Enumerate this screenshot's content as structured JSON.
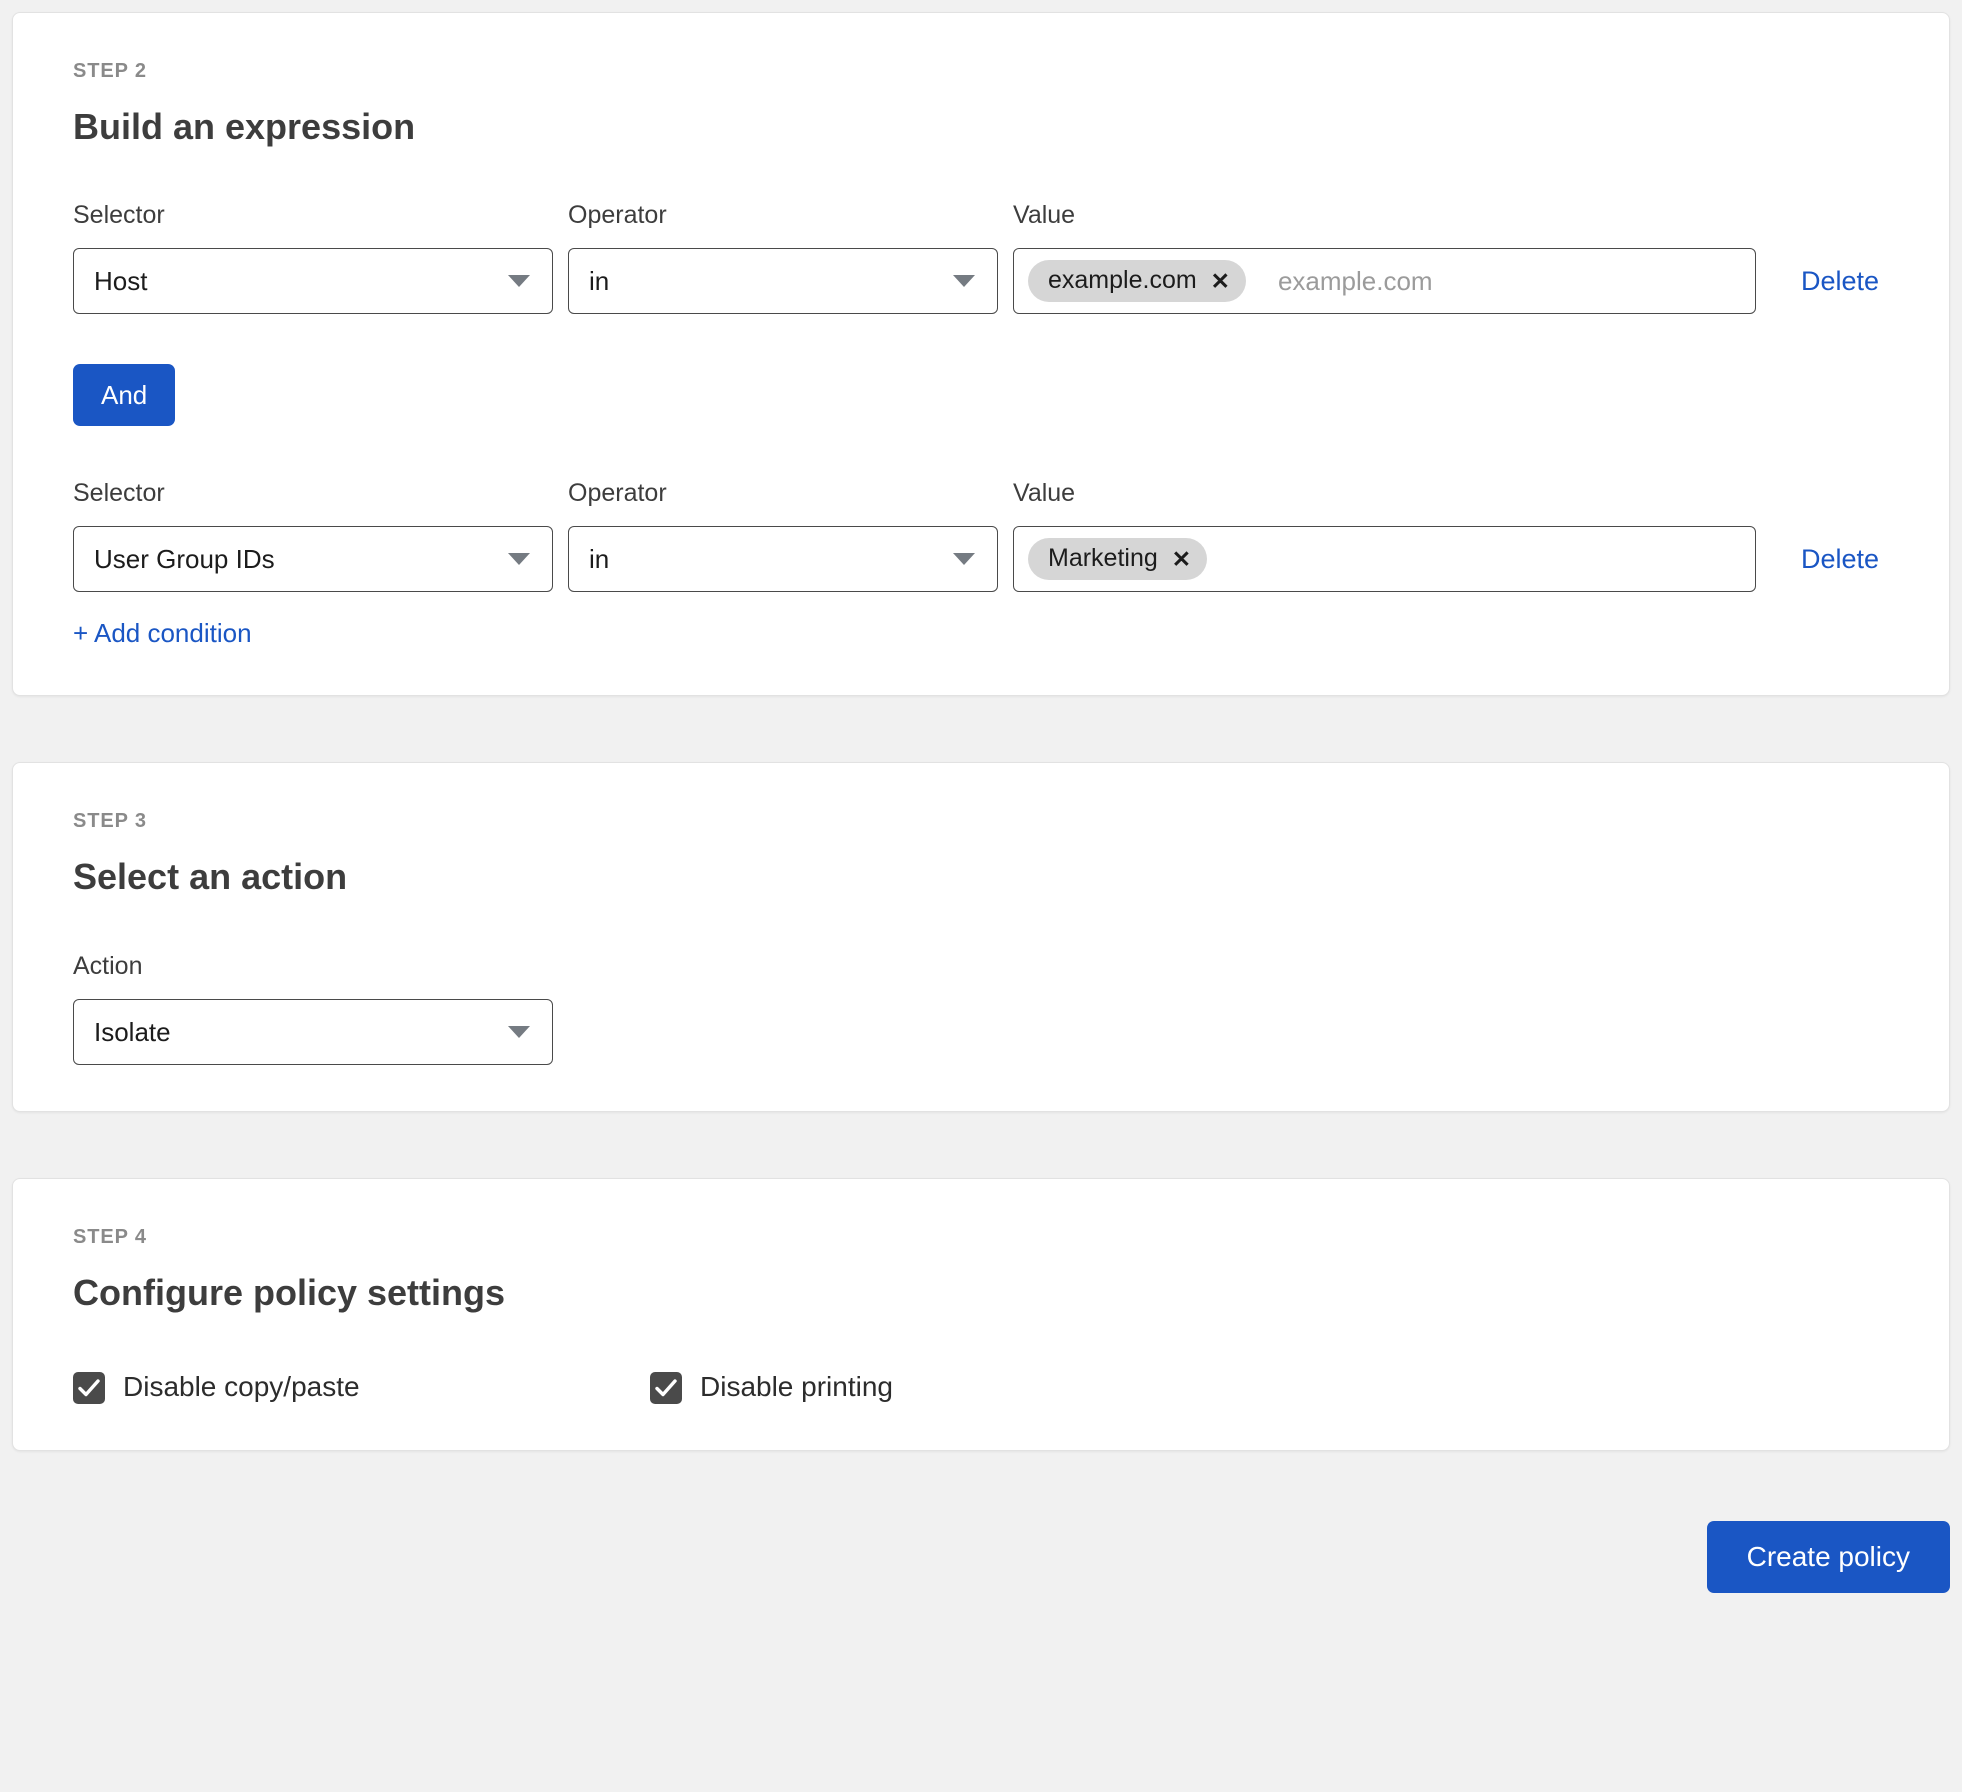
{
  "steps": {
    "build_expression": {
      "step_label": "STEP 2",
      "title": "Build an expression",
      "labels": {
        "selector": "Selector",
        "operator": "Operator",
        "value": "Value"
      },
      "conditions": [
        {
          "selector": "Host",
          "operator": "in",
          "tags": [
            "example.com"
          ],
          "value_placeholder": "example.com",
          "delete_label": "Delete"
        },
        {
          "selector": "User Group IDs",
          "operator": "in",
          "tags": [
            "Marketing"
          ],
          "value_placeholder": "",
          "delete_label": "Delete"
        }
      ],
      "conjunction_label": "And",
      "add_condition_label": "+ Add condition"
    },
    "select_action": {
      "step_label": "STEP 3",
      "title": "Select an action",
      "action_label": "Action",
      "action_value": "Isolate"
    },
    "policy_settings": {
      "step_label": "STEP 4",
      "title": "Configure policy settings",
      "settings": [
        {
          "label": "Disable copy/paste",
          "checked": true
        },
        {
          "label": "Disable printing",
          "checked": true
        }
      ]
    }
  },
  "footer": {
    "submit_label": "Create policy"
  },
  "icons": {
    "chevron_down": "caret-down-icon",
    "chip_remove": "✕",
    "check": "check-icon"
  },
  "colors": {
    "accent": "#1a56c4",
    "page_bg": "#f1f1f1",
    "card_bg": "#ffffff",
    "border": "#4a4a4a",
    "chip_bg": "#d6d6d6",
    "checkbox_fill": "#4a4a4a",
    "muted_text": "#8a8a8a"
  }
}
